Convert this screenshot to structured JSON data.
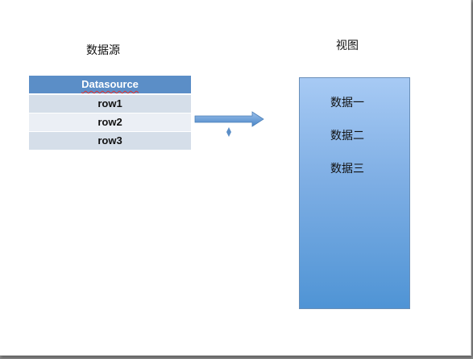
{
  "labels": {
    "source": "数据源",
    "view": "视图"
  },
  "table": {
    "header": "Datasource",
    "rows": [
      "row1",
      "row2",
      "row3"
    ]
  },
  "view_box": {
    "items": [
      "数据一",
      "数据二",
      "数据三"
    ]
  },
  "colors": {
    "table_header": "#5b8ec7",
    "row_dark": "#d5dee9",
    "row_light": "#ebeff5",
    "arrow": "#5b8ec7",
    "view_top": "#a7caf4",
    "view_bottom": "#4f94d5"
  }
}
